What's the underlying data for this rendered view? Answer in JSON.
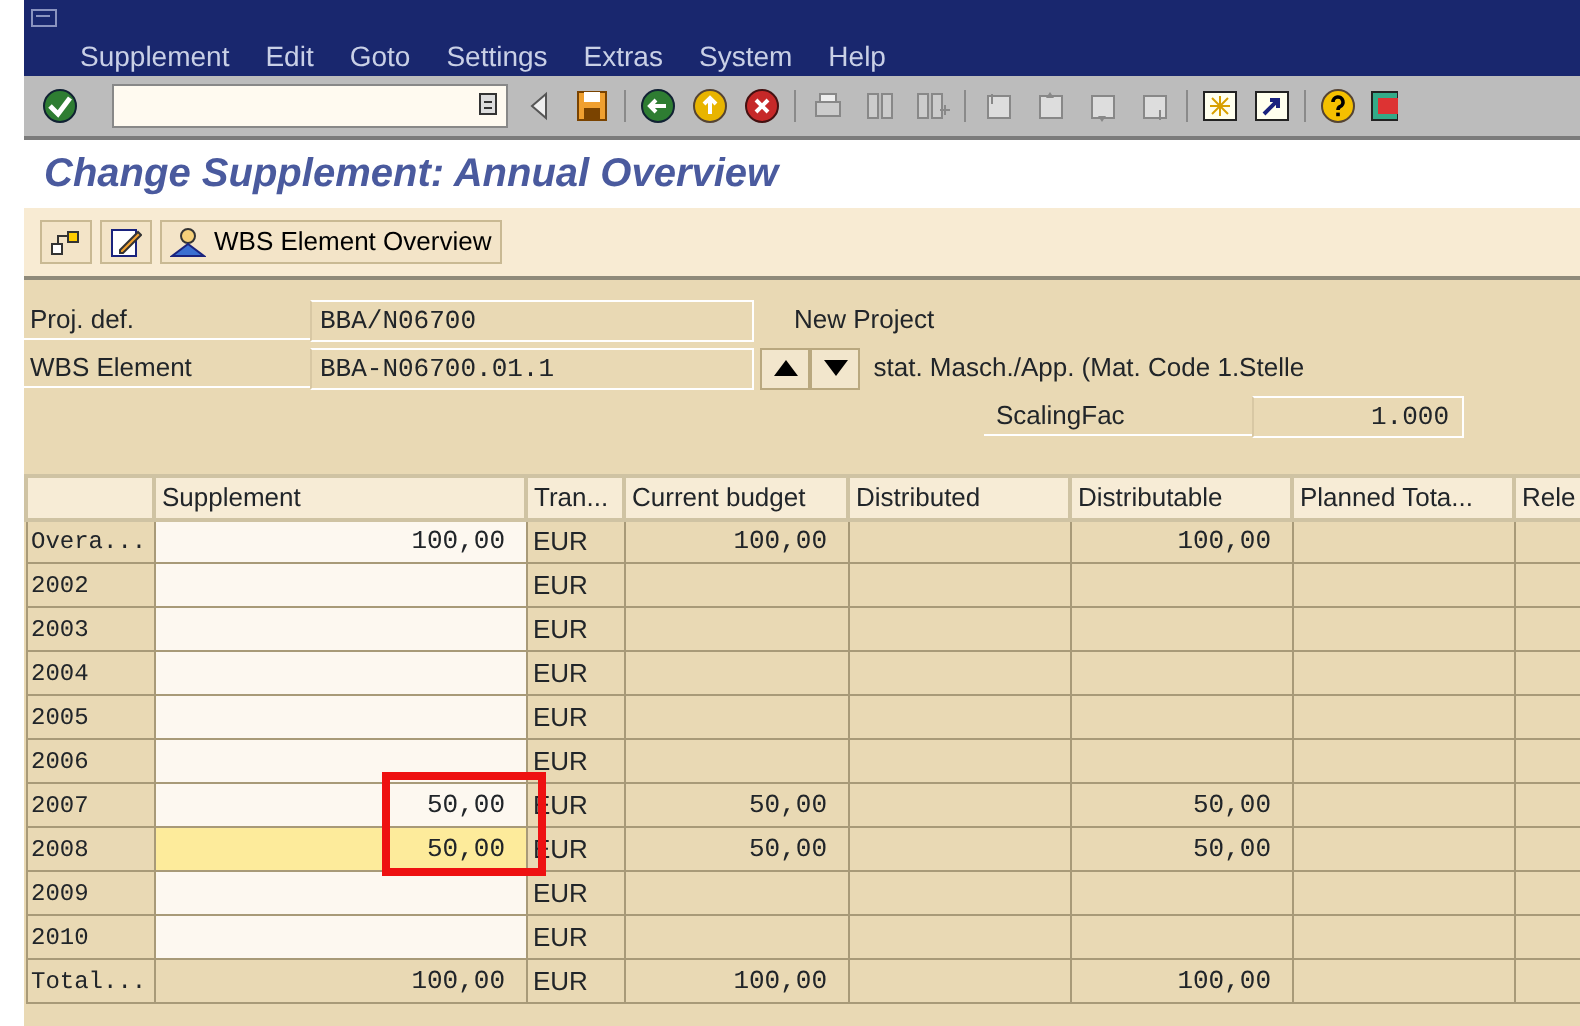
{
  "menu_bar": [
    "Supplement",
    "Edit",
    "Goto",
    "Settings",
    "Extras",
    "System",
    "Help"
  ],
  "screen_title": "Change Supplement: Annual Overview",
  "app_toolbar": {
    "button_label": "WBS Element Overview"
  },
  "header": {
    "proj_def": {
      "label": "Proj. def.",
      "value": "BBA/N06700",
      "description": "New Project"
    },
    "wbs_element": {
      "label": "WBS Element",
      "value": "BBA-N06700.01.1",
      "description": "stat. Masch./App. (Mat. Code 1.Stelle"
    },
    "scaling": {
      "label": "ScalingFac",
      "value": "1.000"
    }
  },
  "table": {
    "columns": [
      "",
      "Supplement",
      "Tran...",
      "Current budget",
      "Distributed",
      "Distributable",
      "Planned Tota...",
      "Rele"
    ],
    "rows": [
      {
        "period": "Overa...",
        "supplement": "100,00",
        "editable": true,
        "focused": false,
        "highlighted": false,
        "currency": "EUR",
        "current_budget": "100,00",
        "distributed": "",
        "distributable": "100,00"
      },
      {
        "period": "2002",
        "supplement": "",
        "editable": true,
        "focused": false,
        "highlighted": false,
        "currency": "EUR",
        "current_budget": "",
        "distributed": "",
        "distributable": ""
      },
      {
        "period": "2003",
        "supplement": "",
        "editable": true,
        "focused": false,
        "highlighted": false,
        "currency": "EUR",
        "current_budget": "",
        "distributed": "",
        "distributable": ""
      },
      {
        "period": "2004",
        "supplement": "",
        "editable": true,
        "focused": false,
        "highlighted": false,
        "currency": "EUR",
        "current_budget": "",
        "distributed": "",
        "distributable": ""
      },
      {
        "period": "2005",
        "supplement": "",
        "editable": true,
        "focused": false,
        "highlighted": false,
        "currency": "EUR",
        "current_budget": "",
        "distributed": "",
        "distributable": ""
      },
      {
        "period": "2006",
        "supplement": "",
        "editable": true,
        "focused": false,
        "highlighted": false,
        "currency": "EUR",
        "current_budget": "",
        "distributed": "",
        "distributable": ""
      },
      {
        "period": "2007",
        "supplement": "50,00",
        "editable": true,
        "focused": false,
        "highlighted": true,
        "currency": "EUR",
        "current_budget": "50,00",
        "distributed": "",
        "distributable": "50,00"
      },
      {
        "period": "2008",
        "supplement": "50,00",
        "editable": true,
        "focused": true,
        "highlighted": true,
        "currency": "EUR",
        "current_budget": "50,00",
        "distributed": "",
        "distributable": "50,00"
      },
      {
        "period": "2009",
        "supplement": "",
        "editable": true,
        "focused": false,
        "highlighted": false,
        "currency": "EUR",
        "current_budget": "",
        "distributed": "",
        "distributable": ""
      },
      {
        "period": "2010",
        "supplement": "",
        "editable": true,
        "focused": false,
        "highlighted": false,
        "currency": "EUR",
        "current_budget": "",
        "distributed": "",
        "distributable": ""
      },
      {
        "period": "Total...",
        "supplement": "100,00",
        "editable": false,
        "focused": false,
        "highlighted": false,
        "currency": "EUR",
        "current_budget": "100,00",
        "distributed": "",
        "distributable": "100,00"
      }
    ]
  }
}
